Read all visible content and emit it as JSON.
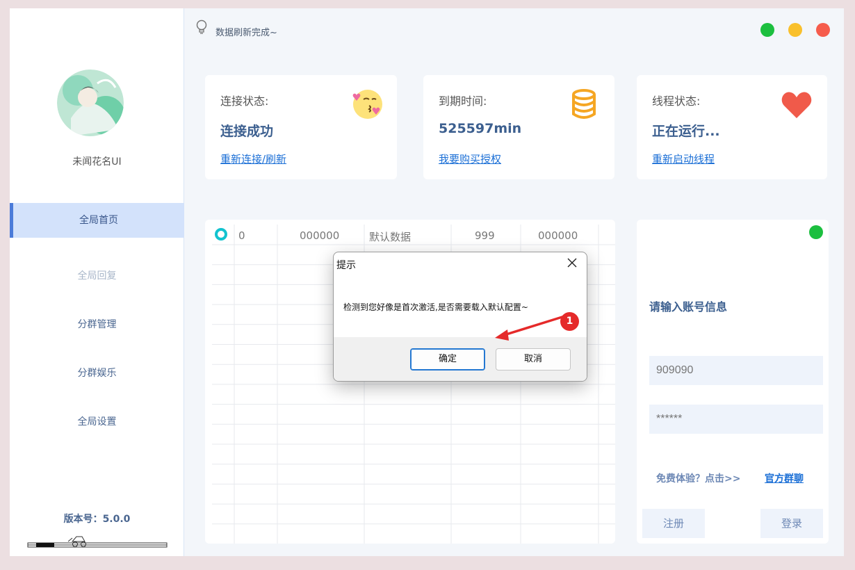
{
  "window": {
    "status_message": "数据刷新完成~",
    "window_controls": [
      {
        "name": "maximize",
        "color": "#1cbf3f"
      },
      {
        "name": "minimize",
        "color": "#f9c02c"
      },
      {
        "name": "close",
        "color": "#f65c4c"
      }
    ]
  },
  "sidebar": {
    "app_name": "未闻花名UI",
    "avatar_icon": "avatar-illustration",
    "nav": [
      {
        "label": "全局首页",
        "state": "active"
      },
      {
        "label": "全局回复",
        "state": "disabled"
      },
      {
        "label": "分群管理",
        "state": "normal"
      },
      {
        "label": "分群娱乐",
        "state": "normal"
      },
      {
        "label": "全局设置",
        "state": "normal"
      }
    ],
    "version_label": "版本号：",
    "version": "5.0.0"
  },
  "cards": [
    {
      "title": "连接状态:",
      "value": "连接成功",
      "link": "重新连接/刷新",
      "icon": "kiss-emoji-icon"
    },
    {
      "title": "到期时间:",
      "value": "525597min",
      "link": "我要购买授权",
      "icon": "database-icon"
    },
    {
      "title": "线程状态:",
      "value": "正在运行...",
      "link": "重新启动线程",
      "icon": "heart-icon"
    }
  ],
  "grid": {
    "first_row": [
      "0",
      "000000",
      "默认数据",
      "999",
      "000000"
    ]
  },
  "login": {
    "status_color": "#1cbf3f",
    "title": "请输入账号信息",
    "account_value": "909090",
    "password_placeholder": "******",
    "trial_text": "免费体验？点击>>",
    "group_link": "官方群聊",
    "register_label": "注册",
    "login_label": "登录"
  },
  "dialog": {
    "title": "提示",
    "message": "检测到您好像是首次激活,是否需要载入默认配置~",
    "ok_label": "确定",
    "cancel_label": "取消"
  },
  "annotation": {
    "badge": "1"
  }
}
